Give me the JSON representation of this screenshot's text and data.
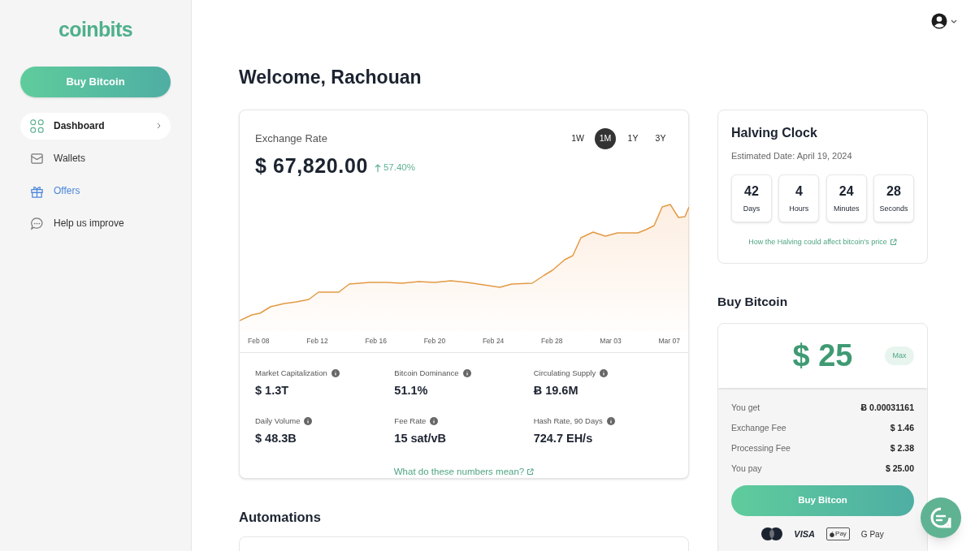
{
  "sidebar": {
    "logo": "coinbits",
    "buy_button": "Buy Bitcoin",
    "items": [
      {
        "label": "Dashboard",
        "selected": true,
        "highlighted": false
      },
      {
        "label": "Wallets",
        "selected": false,
        "highlighted": false
      },
      {
        "label": "Offers",
        "selected": false,
        "highlighted": true
      },
      {
        "label": "Help us improve",
        "selected": false,
        "highlighted": false
      }
    ]
  },
  "header": {
    "title": "Welcome, Rachouan"
  },
  "exchange_rate": {
    "title": "Exchange Rate",
    "price": "$ 67,820.00",
    "change": "57.40%",
    "ranges": [
      {
        "label": "1W",
        "selected": false
      },
      {
        "label": "1M",
        "selected": true
      },
      {
        "label": "1Y",
        "selected": false
      },
      {
        "label": "3Y",
        "selected": false
      }
    ],
    "x_labels": [
      "Feb 08",
      "Feb 12",
      "Feb 16",
      "Feb 20",
      "Feb 24",
      "Feb 28",
      "Mar 03",
      "Mar 07"
    ],
    "stats": [
      {
        "label": "Market Capitalization",
        "value": "$ 1.3T"
      },
      {
        "label": "Bitcoin Dominance",
        "value": "51.1%"
      },
      {
        "label": "Circulating Supply",
        "value": "Ƀ 19.6M"
      },
      {
        "label": "Daily Volume",
        "value": "$ 48.3B"
      },
      {
        "label": "Fee Rate",
        "value": "15 sat/vB"
      },
      {
        "label": "Hash Rate, 90 Days",
        "value": "724.7 EH/s"
      }
    ],
    "link": "What do these numbers mean?"
  },
  "halving_clock": {
    "title": "Halving Clock",
    "date": "Estimated Date: April 19, 2024",
    "units": [
      {
        "value": "42",
        "label": "Days"
      },
      {
        "value": "4",
        "label": "Hours"
      },
      {
        "value": "24",
        "label": "Minutes"
      },
      {
        "value": "28",
        "label": "Seconds"
      }
    ],
    "link": "How the Halving could affect bitcoin's price"
  },
  "buy": {
    "title": "Buy Bitcoin",
    "amount": "$ 25",
    "max_button": "Max",
    "rows": [
      {
        "label": "You get",
        "value": "Ƀ 0.00031161"
      },
      {
        "label": "Exchange Fee",
        "value": "$ 1.46"
      },
      {
        "label": "Processing Fee",
        "value": "$ 2.38"
      },
      {
        "label": "You pay",
        "value": "$ 25.00"
      }
    ],
    "button": "Buy Bitcon",
    "payment_methods": [
      {
        "kind": "mastercard"
      },
      {
        "kind": "visa",
        "text": "VISA"
      },
      {
        "kind": "applepay",
        "text": "Pay"
      },
      {
        "kind": "gpay",
        "text": "G Pay"
      }
    ]
  },
  "automations": {
    "title": "Automations"
  }
}
